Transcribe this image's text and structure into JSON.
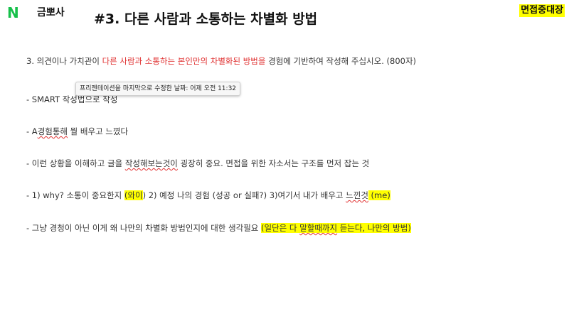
{
  "brand": {
    "logo_letter": "N",
    "logo_text": "금뽀사",
    "logo_color": "#16c04a"
  },
  "slide": {
    "title": "#3. 다른 사람과 소통하는 차별화 방법",
    "corner_badge": "면접중대장"
  },
  "question": {
    "prefix": "3. 의견이나 가치관이 ",
    "highlight": "다른 사람과 소통하는 본인만의 차별화된 방법을",
    "suffix": " 경험에 기반하여 작성해 주십시오. (800자)"
  },
  "bullets": {
    "b1": "- SMART 작성법으로 작성",
    "b2_prefix": "- A",
    "b2_word": "경험통해",
    "b2_suffix": " 뭘 배우고 느꼈다",
    "b3_prefix": "- 이런 상황을 이해하고 글을 ",
    "b3_word": "작성해보는것이",
    "b3_suffix": " 굉장히 중요. 면접을 위한 자소서는 구조를 먼저 잡는 것",
    "b4_prefix": "- 1) why? 소통이 중요한지 ",
    "b4_hl1": " (와이",
    "b4_mid": ")  2) 예정 나의 경험 (성공 or 실패?)  3)여기서 내가 배우고 ",
    "b4_word": "느낀것",
    "b4_hl2": " (me)",
    "b5_prefix": "- 그냥 경청이 아닌 이게 왜 나만의 차별화 방법인지에 대한 생각필요 ",
    "b5_hl_a": "(일단은 다 ",
    "b5_hl_word": "말할때까지",
    "b5_hl_b": " 듣는다, 나만의 방법)"
  },
  "tooltip": {
    "text": "프리젠테이션을 마지막으로 수정한 날짜: 어제 오전 11:32"
  },
  "colors": {
    "highlight": "#ffff00",
    "accent_red": "#e03131"
  }
}
